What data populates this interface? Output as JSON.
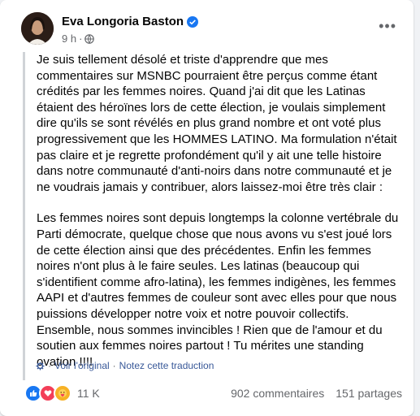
{
  "post": {
    "author": "Eva Longoria Baston",
    "time": "9 h",
    "more_icon": "•••",
    "paragraphs": [
      "Je suis tellement désolé et triste d'apprendre que mes commentaires sur MSNBC pourraient être perçus comme étant crédités par les femmes noires. Quand j'ai dit que les Latinas étaient des héroïnes lors de cette élection, je voulais simplement dire qu'ils se sont révélés en plus grand nombre et ont voté plus progressivement que les HOMMES LATINO. Ma formulation n'était pas claire et je regrette profondément qu'il y ait une telle histoire dans notre communauté d'anti-noirs dans notre communauté et je ne voudrais jamais y contribuer, alors laissez-moi être très clair :",
      "Les femmes noires sont depuis longtemps la colonne vertébrale du Parti démocrate, quelque chose que nous avons vu s'est joué lors de cette élection ainsi que des précédentes. Enfin les femmes noires n'ont plus à le faire seules. Les latinas (beaucoup qui s'identifient comme afro-latina), les femmes indigènes, les femmes AAPI et d'autres femmes de couleur sont avec elles pour que nous puissions développer notre voix et notre pouvoir collectifs. Ensemble, nous sommes invincibles ! Rien que de l'amour et du soutien aux femmes noires partout ! Tu mérites une standing ovation !!!!"
    ],
    "translation": {
      "view_original": "Voir l'original",
      "separator": "·",
      "rate": "Notez cette traduction"
    },
    "reactions_count": "11 K",
    "comments": "902 commentaires",
    "shares": "151 partages"
  },
  "colors": {
    "accent": "#1877f2",
    "link": "#385898",
    "secondary_text": "#65676b"
  }
}
